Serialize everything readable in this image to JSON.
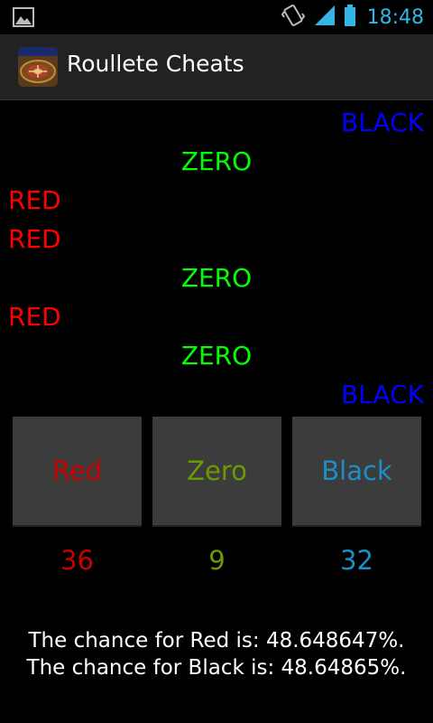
{
  "status_bar": {
    "time": "18:48",
    "icons": [
      "image-notification-icon",
      "vibrate-icon",
      "signal-icon",
      "battery-icon"
    ]
  },
  "action_bar": {
    "title": "Roullete Cheats",
    "icon": "roulette-wheel-icon"
  },
  "history": [
    {
      "label": "BLACK",
      "kind": "black"
    },
    {
      "label": "ZERO",
      "kind": "zero"
    },
    {
      "label": "RED",
      "kind": "red"
    },
    {
      "label": "RED",
      "kind": "red"
    },
    {
      "label": "ZERO",
      "kind": "zero"
    },
    {
      "label": "RED",
      "kind": "red"
    },
    {
      "label": "ZERO",
      "kind": "zero"
    },
    {
      "label": "BLACK",
      "kind": "black"
    }
  ],
  "buttons": {
    "red_label": "Red",
    "zero_label": "Zero",
    "black_label": "Black"
  },
  "counts": {
    "red": "36",
    "zero": "9",
    "black": "32"
  },
  "chances": {
    "red_text": "The chance for Red is: 48.648647%.",
    "black_text": "The chance for Black is: 48.64865%."
  },
  "colors": {
    "history_black": "#0000ff",
    "history_zero": "#00ff00",
    "history_red": "#ff0000",
    "button_red": "#c80000",
    "button_zero": "#6a9a00",
    "button_black": "#1a8fc8",
    "clock": "#33b5e5"
  }
}
